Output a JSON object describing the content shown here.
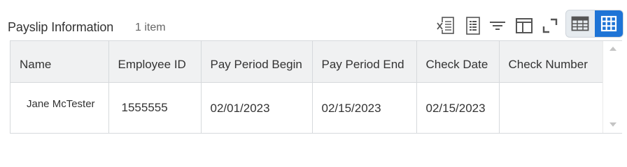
{
  "grid": {
    "title": "Payslip Information",
    "item_count": "1 item",
    "columns": [
      "Name",
      "Employee ID",
      "Pay Period Begin",
      "Pay Period End",
      "Check Date",
      "Check Number"
    ],
    "rows": [
      [
        "Jane McTester",
        "1555555",
        "02/01/2023",
        "02/15/2023",
        "02/15/2023",
        ""
      ]
    ]
  },
  "toolbar": {
    "icons": [
      "export-to-excel-icon",
      "export-to-worksheets-icon",
      "filter-icon",
      "column-layout-icon",
      "fullscreen-icon"
    ],
    "view_toggle": {
      "selected": "grid-view",
      "options": [
        "table-view-icon",
        "grid-view-icon"
      ],
      "accent": "#1e74d6"
    }
  }
}
